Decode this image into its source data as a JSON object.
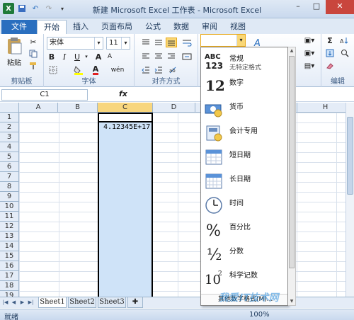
{
  "window": {
    "title": "新建 Microsoft Excel 工作表 - Microsoft Excel",
    "controls": [
      "–",
      "□",
      "✕"
    ]
  },
  "tabs": [
    "文件",
    "开始",
    "插入",
    "页面布局",
    "公式",
    "数据",
    "审阅",
    "视图"
  ],
  "ribbon": {
    "clipboard": {
      "label": "剪贴板",
      "paste": "粘贴"
    },
    "font": {
      "label": "字体",
      "font_name": "宋体",
      "font_size": "11",
      "bold": "B",
      "italic": "I",
      "underline": "U",
      "grow": "A",
      "shrink": "A",
      "wen": "wén"
    },
    "alignment": {
      "label": "对齐方式"
    },
    "number": {
      "format_value": ""
    },
    "editing": {
      "label": "编辑",
      "sigma": "Σ"
    }
  },
  "formula_bar": {
    "name_box": "C1",
    "fx": "fx",
    "content": ""
  },
  "grid": {
    "columns": [
      "A",
      "B",
      "C",
      "D",
      "H"
    ],
    "rows": [
      "1",
      "2",
      "3",
      "4",
      "5",
      "6",
      "7",
      "8",
      "9",
      "10",
      "11",
      "12",
      "13",
      "14",
      "15",
      "16",
      "17",
      "18",
      "19"
    ],
    "cell_c2": "4.12345E+17"
  },
  "number_format_menu": {
    "items": [
      {
        "label": "常规",
        "sub": "无特定格式",
        "icon_text": "ABC\n123"
      },
      {
        "label": "数字",
        "icon_text": "12"
      },
      {
        "label": "货币"
      },
      {
        "label": "会计专用"
      },
      {
        "label": "短日期"
      },
      {
        "label": "长日期"
      },
      {
        "label": "时间"
      },
      {
        "label": "百分比",
        "icon_text": "%"
      },
      {
        "label": "分数",
        "icon_text": "½"
      },
      {
        "label": "科学记数",
        "icon_text": "10²"
      }
    ],
    "footer": "其他数字格式(M)..."
  },
  "sheets": [
    "Sheet1",
    "Sheet2",
    "Sheet3"
  ],
  "status": {
    "ready": "就绪",
    "zoom": "100%"
  },
  "watermark": "我爱IT技术网",
  "colors": {
    "accent": "#2a6fbf",
    "selection": "#cfe3f8",
    "highlight": "#fff3c7"
  }
}
